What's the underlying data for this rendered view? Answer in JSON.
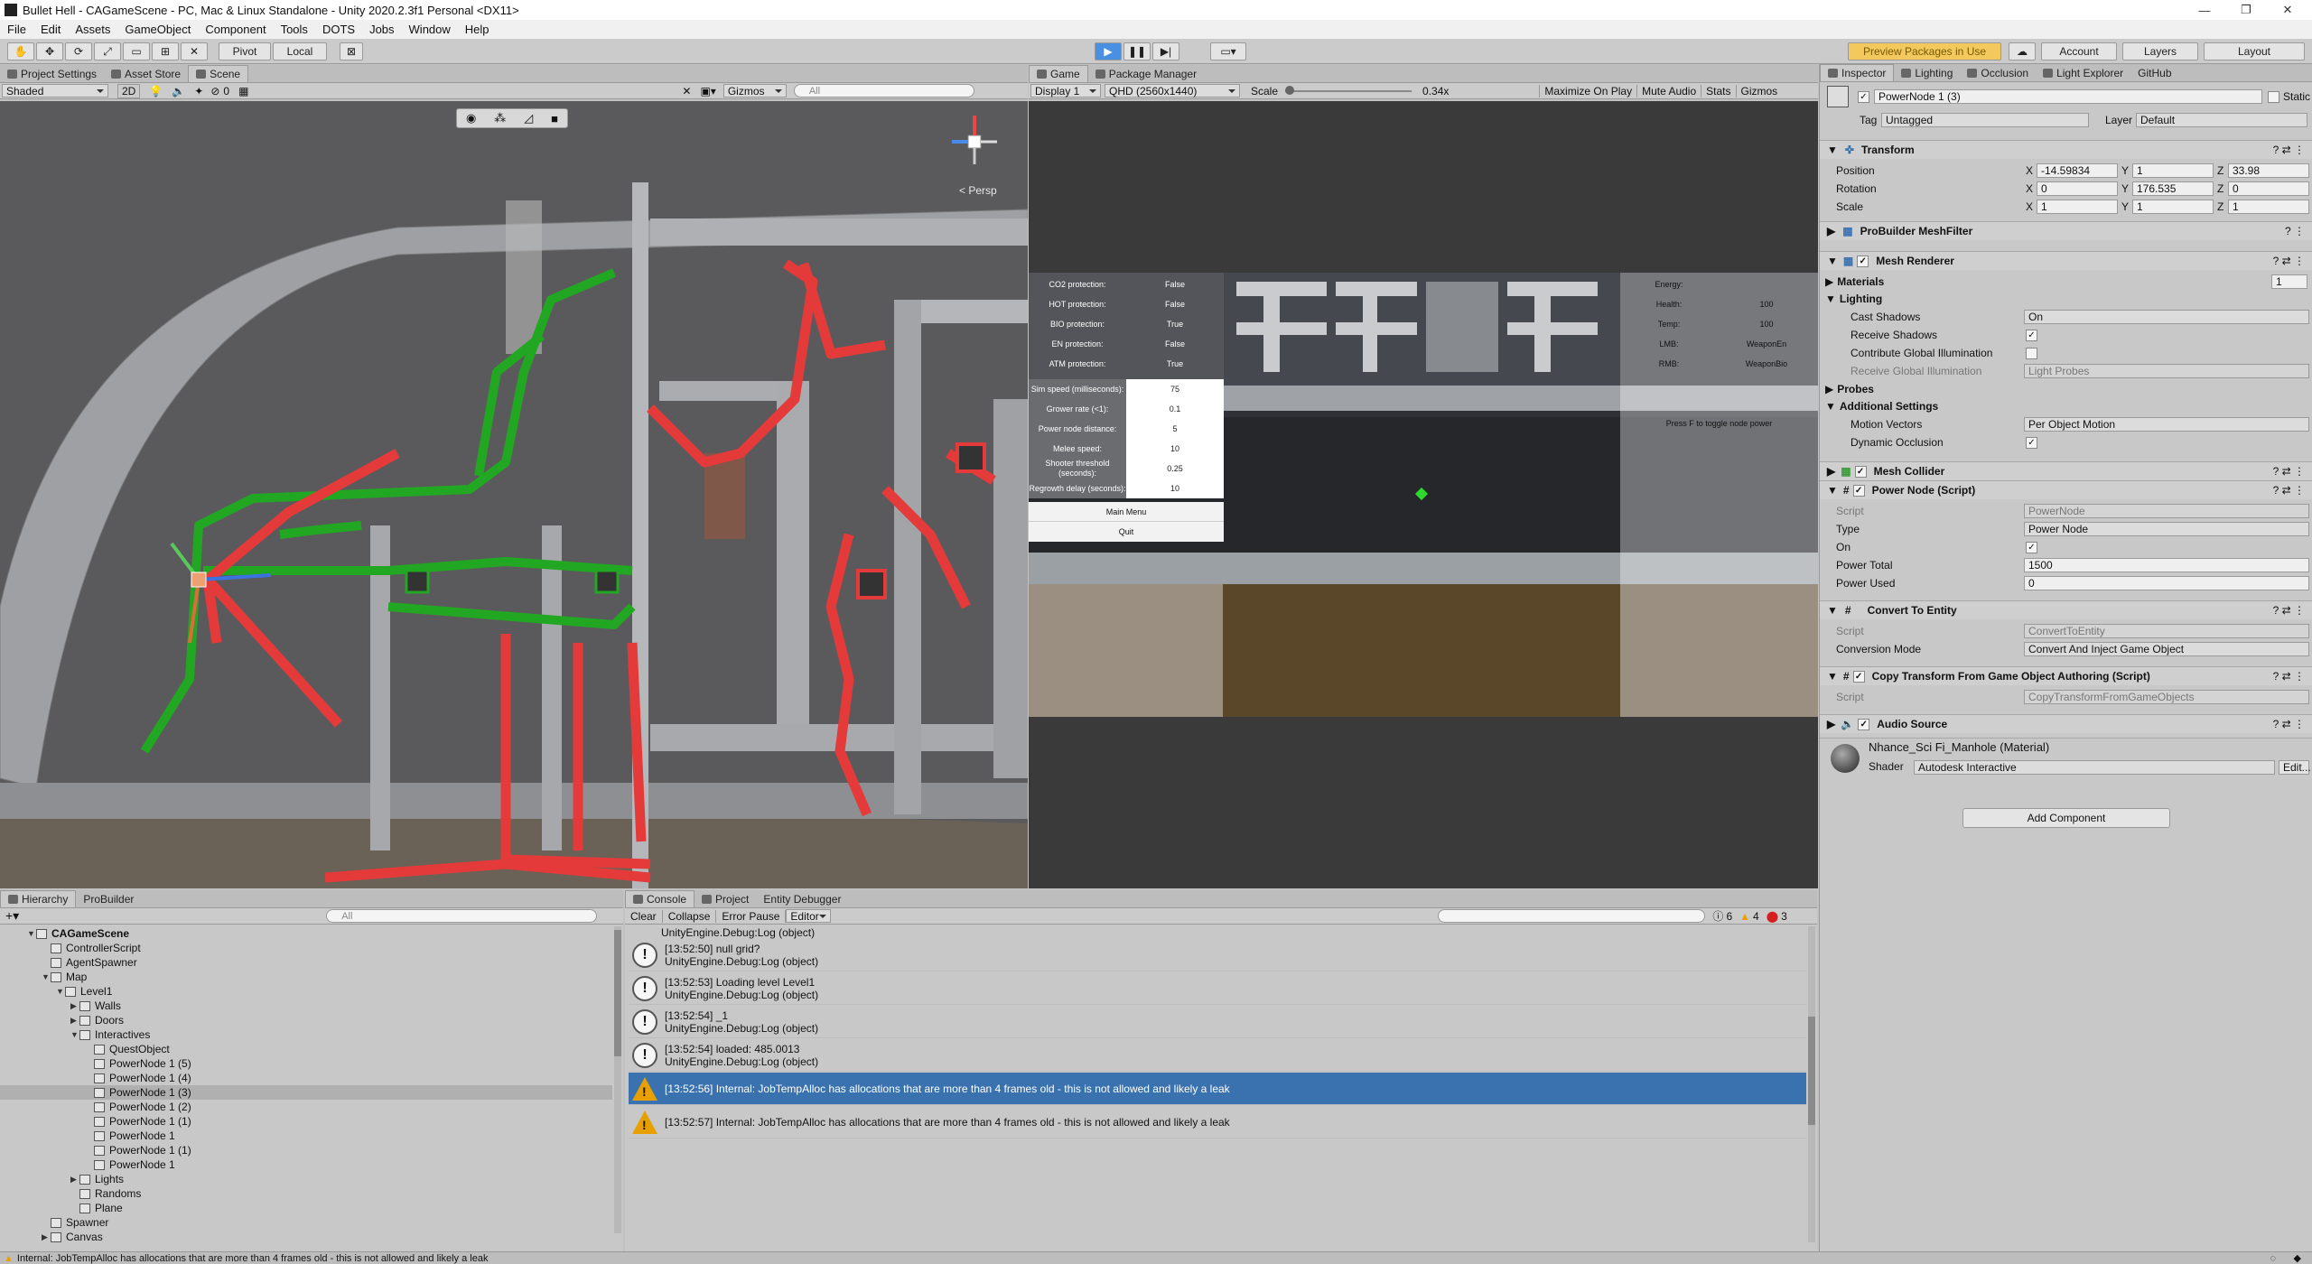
{
  "window": {
    "title": "Bullet Hell - CAGameScene - PC, Mac & Linux Standalone - Unity 2020.2.3f1 Personal <DX11>",
    "controls": [
      "—",
      "❐",
      "✕"
    ]
  },
  "menu": [
    "File",
    "Edit",
    "Assets",
    "GameObject",
    "Component",
    "Tools",
    "DOTS",
    "Jobs",
    "Window",
    "Help"
  ],
  "toolbar": {
    "pivot": "Pivot",
    "local": "Local",
    "preview": "Preview Packages in Use",
    "account": "Account",
    "layers": "Layers",
    "layout": "Layout"
  },
  "scene_tabs": {
    "tabs": [
      "Project Settings",
      "Asset Store",
      "Scene"
    ],
    "shading": "Shaded",
    "mode_2d": "2D",
    "fx_count": "0",
    "gizmos": "Gizmos",
    "search": "All",
    "persp": "< Persp"
  },
  "game_tabs": {
    "tabs": [
      "Game",
      "Package Manager"
    ],
    "display": "Display 1",
    "resolution": "QHD (2560x1440)",
    "scale_label": "Scale",
    "scale_value": "0.34x",
    "options": [
      "Maximize On Play",
      "Mute Audio",
      "Stats",
      "Gizmos"
    ]
  },
  "game_ui": {
    "left_rows": [
      [
        "CO2 protection:",
        "False"
      ],
      [
        "HOT protection:",
        "False"
      ],
      [
        "BIO protection:",
        "True"
      ],
      [
        "EN protection:",
        "False"
      ],
      [
        "ATM protection:",
        "True"
      ]
    ],
    "settings": [
      [
        "Sim speed (milliseconds):",
        "75"
      ],
      [
        "Grower rate (<1):",
        "0.1"
      ],
      [
        "Power node distance:",
        "5"
      ],
      [
        "Melee speed:",
        "10"
      ],
      [
        "Shooter threshold (seconds):",
        "0.25"
      ],
      [
        "Regrowth delay (seconds):",
        "10"
      ]
    ],
    "buttons": [
      "Main Menu",
      "Quit"
    ],
    "right_rows": [
      [
        "Energy:",
        ""
      ],
      [
        "Health:",
        "100"
      ],
      [
        "Temp:",
        "100"
      ],
      [
        "LMB:",
        "WeaponEn"
      ],
      [
        "RMB:",
        "WeaponBio"
      ]
    ],
    "hint": "Press F to toggle node power"
  },
  "inspector": {
    "tabs": [
      "Inspector",
      "Lighting",
      "Occlusion",
      "Light Explorer",
      "GitHub"
    ],
    "object_name": "PowerNode 1 (3)",
    "static": "Static",
    "tag_label": "Tag",
    "tag": "Untagged",
    "layer_label": "Layer",
    "layer": "Default",
    "transform": {
      "title": "Transform",
      "position_label": "Position",
      "rotation_label": "Rotation",
      "scale_label": "Scale",
      "position": [
        "-14.59834",
        "1",
        "33.98"
      ],
      "rotation": [
        "0",
        "176.535",
        "0"
      ],
      "scale": [
        "1",
        "1",
        "1"
      ]
    },
    "meshfilter": "ProBuilder MeshFilter",
    "meshrenderer": {
      "title": "Mesh Renderer",
      "materials": "Materials",
      "materials_count": "1",
      "lighting": "Lighting",
      "cast_shadows_label": "Cast Shadows",
      "cast_shadows": "On",
      "receive_shadows": "Receive Shadows",
      "contribute_gi": "Contribute Global Illumination",
      "receive_gi_label": "Receive Global Illumination",
      "receive_gi": "Light Probes",
      "probes": "Probes",
      "additional": "Additional Settings",
      "motion_label": "Motion Vectors",
      "motion": "Per Object Motion",
      "dynamic_occlusion": "Dynamic Occlusion"
    },
    "mesh_collider": "Mesh Collider",
    "power_node": {
      "title": "Power Node (Script)",
      "script_label": "Script",
      "script": "PowerNode",
      "type_label": "Type",
      "type": "Power Node",
      "on_label": "On",
      "total_label": "Power Total",
      "total": "1500",
      "used_label": "Power Used",
      "used": "0"
    },
    "convert": {
      "title": "Convert To Entity",
      "script_label": "Script",
      "script": "ConvertToEntity",
      "mode_label": "Conversion Mode",
      "mode": "Convert And Inject Game Object"
    },
    "copy": {
      "title": "Copy Transform From Game Object Authoring (Script)",
      "script_label": "Script",
      "script": "CopyTransformFromGameObjects"
    },
    "audio": "Audio Source",
    "material": {
      "name": "Nhance_Sci Fi_Manhole (Material)",
      "shader_label": "Shader",
      "shader": "Autodesk Interactive",
      "edit": "Edit..."
    },
    "add_component": "Add Component"
  },
  "hierarchy": {
    "tabs": [
      "Hierarchy",
      "ProBuilder"
    ],
    "search": "All",
    "items": [
      {
        "label": "CAGameScene",
        "depth": 0,
        "arrow": "▼",
        "bold": true
      },
      {
        "label": "ControllerScript",
        "depth": 1,
        "arrow": ""
      },
      {
        "label": "AgentSpawner",
        "depth": 1,
        "arrow": ""
      },
      {
        "label": "Map",
        "depth": 1,
        "arrow": "▼"
      },
      {
        "label": "Level1",
        "depth": 2,
        "arrow": "▼"
      },
      {
        "label": "Walls",
        "depth": 3,
        "arrow": "▶"
      },
      {
        "label": "Doors",
        "depth": 3,
        "arrow": "▶"
      },
      {
        "label": "Interactives",
        "depth": 3,
        "arrow": "▼"
      },
      {
        "label": "QuestObject",
        "depth": 4,
        "arrow": ""
      },
      {
        "label": "PowerNode 1 (5)",
        "depth": 4,
        "arrow": ""
      },
      {
        "label": "PowerNode 1 (4)",
        "depth": 4,
        "arrow": ""
      },
      {
        "label": "PowerNode 1 (3)",
        "depth": 4,
        "arrow": "",
        "selected": true
      },
      {
        "label": "PowerNode 1 (2)",
        "depth": 4,
        "arrow": ""
      },
      {
        "label": "PowerNode 1 (1)",
        "depth": 4,
        "arrow": ""
      },
      {
        "label": "PowerNode 1",
        "depth": 4,
        "arrow": ""
      },
      {
        "label": "PowerNode 1 (1)",
        "depth": 4,
        "arrow": ""
      },
      {
        "label": "PowerNode 1",
        "depth": 4,
        "arrow": ""
      },
      {
        "label": "Lights",
        "depth": 3,
        "arrow": "▶"
      },
      {
        "label": "Randoms",
        "depth": 3,
        "arrow": ""
      },
      {
        "label": "Plane",
        "depth": 3,
        "arrow": ""
      },
      {
        "label": "Spawner",
        "depth": 1,
        "arrow": ""
      },
      {
        "label": "Canvas",
        "depth": 1,
        "arrow": "▶"
      }
    ]
  },
  "console": {
    "tabs": [
      "Console",
      "Project",
      "Entity Debugger"
    ],
    "buttons": [
      "Clear",
      "Collapse",
      "Error Pause",
      "Editor"
    ],
    "counts": {
      "info": "6",
      "warn": "4",
      "error": "3"
    },
    "top_line": "UnityEngine.Debug:Log (object)",
    "messages": [
      {
        "l1": "[13:52:50] null grid?",
        "l2": "UnityEngine.Debug:Log (object)",
        "kind": "info"
      },
      {
        "l1": "[13:52:53] Loading level Level1",
        "l2": "UnityEngine.Debug:Log (object)",
        "kind": "info"
      },
      {
        "l1": "[13:52:54] _1",
        "l2": "UnityEngine.Debug:Log (object)",
        "kind": "info"
      },
      {
        "l1": "[13:52:54] loaded: 485.0013",
        "l2": "UnityEngine.Debug:Log (object)",
        "kind": "info"
      },
      {
        "l1": "[13:52:56] Internal: JobTempAlloc has allocations that are more than 4 frames old - this is not allowed and likely a leak",
        "l2": "",
        "kind": "warn",
        "selected": true
      },
      {
        "l1": "[13:52:57] Internal: JobTempAlloc has allocations that are more than 4 frames old - this is not allowed and likely a leak",
        "l2": "",
        "kind": "warn"
      }
    ]
  },
  "status": "Internal: JobTempAlloc has allocations that are more than 4 frames old - this is not allowed and likely a leak",
  "colors": {
    "accent": "#3a72b0",
    "green": "#1fa51f",
    "red": "#e63b3b",
    "warn": "#e8a000"
  }
}
